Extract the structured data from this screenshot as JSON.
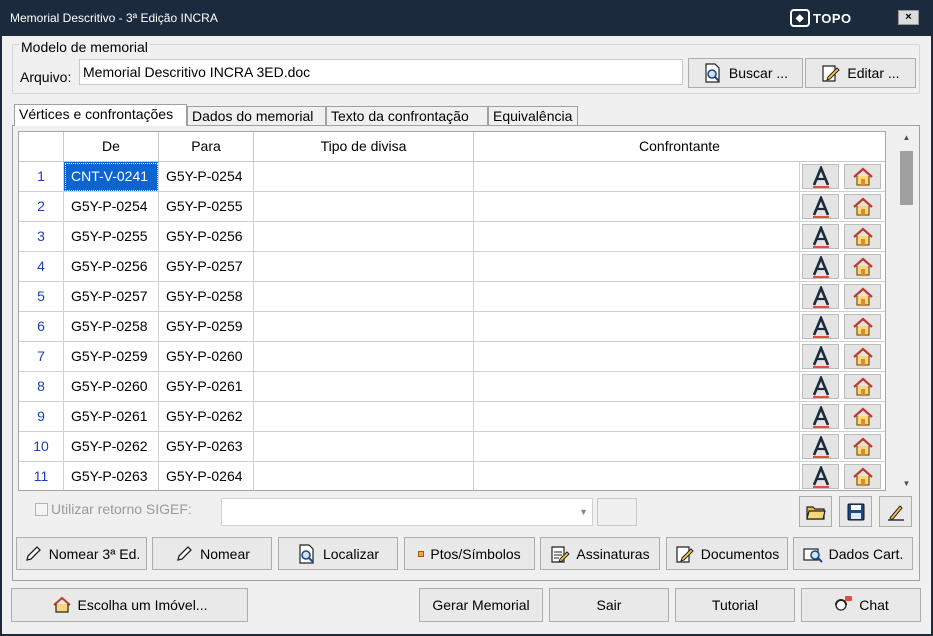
{
  "window": {
    "title": "Memorial Descritivo - 3ª Edição INCRA",
    "brand": "TOPO",
    "close": "×"
  },
  "model_group": {
    "legend": "Modelo de memorial",
    "file_label": "Arquivo:",
    "file_value": "Memorial Descritivo INCRA 3ED.doc",
    "search_button": "Buscar ...",
    "edit_button": "Editar ..."
  },
  "tabs": [
    "Vértices e confrontações",
    "Dados do memorial",
    "Texto da confrontação",
    "Equivalência"
  ],
  "grid": {
    "headers": [
      "",
      "De",
      "Para",
      "Tipo de divisa",
      "Confrontante"
    ],
    "rows": [
      {
        "n": "1",
        "de": "CNT-V-0241",
        "para": "G5Y-P-0254"
      },
      {
        "n": "2",
        "de": "G5Y-P-0254",
        "para": "G5Y-P-0255"
      },
      {
        "n": "3",
        "de": "G5Y-P-0255",
        "para": "G5Y-P-0256"
      },
      {
        "n": "4",
        "de": "G5Y-P-0256",
        "para": "G5Y-P-0257"
      },
      {
        "n": "5",
        "de": "G5Y-P-0257",
        "para": "G5Y-P-0258"
      },
      {
        "n": "6",
        "de": "G5Y-P-0258",
        "para": "G5Y-P-0259"
      },
      {
        "n": "7",
        "de": "G5Y-P-0259",
        "para": "G5Y-P-0260"
      },
      {
        "n": "8",
        "de": "G5Y-P-0260",
        "para": "G5Y-P-0261"
      },
      {
        "n": "9",
        "de": "G5Y-P-0261",
        "para": "G5Y-P-0262"
      },
      {
        "n": "10",
        "de": "G5Y-P-0262",
        "para": "G5Y-P-0263"
      },
      {
        "n": "11",
        "de": "G5Y-P-0263",
        "para": "G5Y-P-0264"
      }
    ],
    "selected_row": 0
  },
  "sigef": {
    "label": "Utilizar retorno SIGEF:"
  },
  "actions": {
    "nomear3": "Nomear 3ª Ed.",
    "nomear": "Nomear",
    "localizar": "Localizar",
    "ptos": "Ptos/Símbolos",
    "assinaturas": "Assinaturas",
    "documentos": "Documentos",
    "dados_cart": "Dados Cart."
  },
  "footer": {
    "escolha": "Escolha um Imóvel...",
    "gerar": "Gerar Memorial",
    "sair": "Sair",
    "tutorial": "Tutorial",
    "chat": "Chat"
  },
  "colors": {
    "titlebar": "#1b2a3d",
    "selection": "#0a64d2",
    "row_number": "#1a3fb3"
  }
}
